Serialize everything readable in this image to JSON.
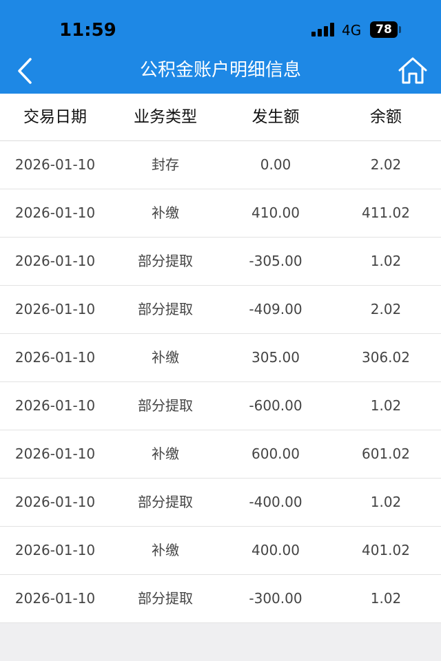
{
  "status_bar": {
    "time": "11:59",
    "network": "4G",
    "battery": "78"
  },
  "header": {
    "title": "公积金账户明细信息",
    "back_icon": "chevron-left-icon",
    "home_icon": "home-icon",
    "background": "#1e88e5"
  },
  "table": {
    "columns": [
      "交易日期",
      "业务类型",
      "发生额",
      "余额"
    ],
    "rows": [
      {
        "date": "2026-01-10",
        "type": "封存",
        "amount": "0.00",
        "balance": "2.02"
      },
      {
        "date": "2026-01-10",
        "type": "补缴",
        "amount": "410.00",
        "balance": "411.02"
      },
      {
        "date": "2026-01-10",
        "type": "部分提取",
        "amount": "-305.00",
        "balance": "1.02"
      },
      {
        "date": "2026-01-10",
        "type": "部分提取",
        "amount": "-409.00",
        "balance": "2.02"
      },
      {
        "date": "2026-01-10",
        "type": "补缴",
        "amount": "305.00",
        "balance": "306.02"
      },
      {
        "date": "2026-01-10",
        "type": "部分提取",
        "amount": "-600.00",
        "balance": "1.02"
      },
      {
        "date": "2026-01-10",
        "type": "补缴",
        "amount": "600.00",
        "balance": "601.02"
      },
      {
        "date": "2026-01-10",
        "type": "部分提取",
        "amount": "-400.00",
        "balance": "1.02"
      },
      {
        "date": "2026-01-10",
        "type": "补缴",
        "amount": "400.00",
        "balance": "401.02"
      },
      {
        "date": "2026-01-10",
        "type": "部分提取",
        "amount": "-300.00",
        "balance": "1.02"
      }
    ]
  }
}
